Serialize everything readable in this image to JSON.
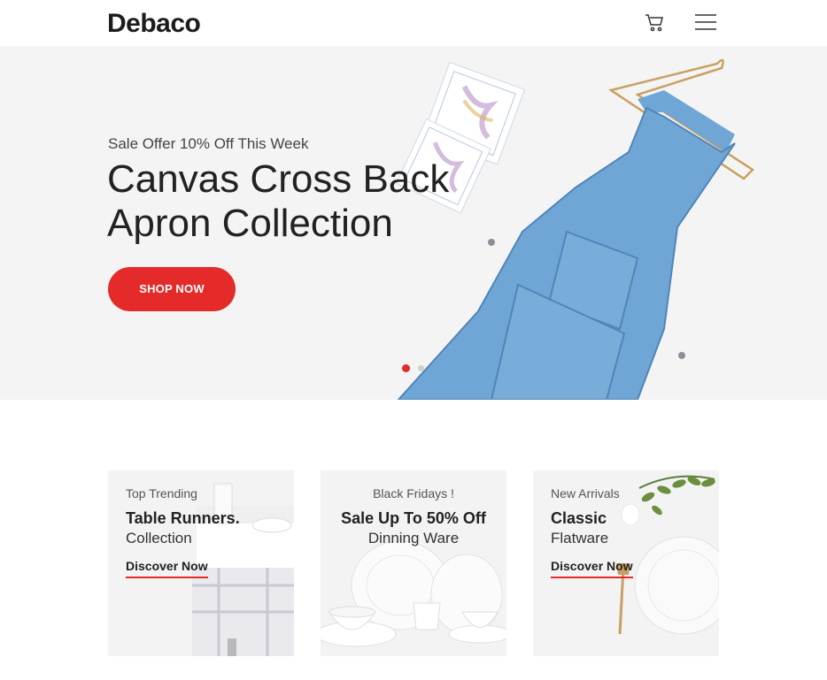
{
  "header": {
    "logo": "Debaco",
    "cart_icon": "cart-icon",
    "menu_icon": "hamburger-menu-icon"
  },
  "hero": {
    "subtitle": "Sale Offer 10% Off This Week",
    "title_line1": "Canvas Cross Back",
    "title_line2": "Apron Collection",
    "button_label": "SHOP NOW",
    "slides": {
      "count": 2,
      "active": 1
    }
  },
  "cards": [
    {
      "label": "Top Trending",
      "title": "Table Runners.",
      "subtitle": "Collection",
      "link": "Discover Now"
    },
    {
      "label": "Black Fridays !",
      "title": "Sale Up To 50% Off",
      "subtitle": "Dinning Ware",
      "link": ""
    },
    {
      "label": "New Arrivals",
      "title": "Classic",
      "subtitle": "Flatware",
      "link": "Discover Now"
    }
  ],
  "colors": {
    "accent": "#e52a2a",
    "hero_bg": "#f4f4f4",
    "card_bg": "#f3f3f3",
    "denim": "#6fa6d6"
  }
}
